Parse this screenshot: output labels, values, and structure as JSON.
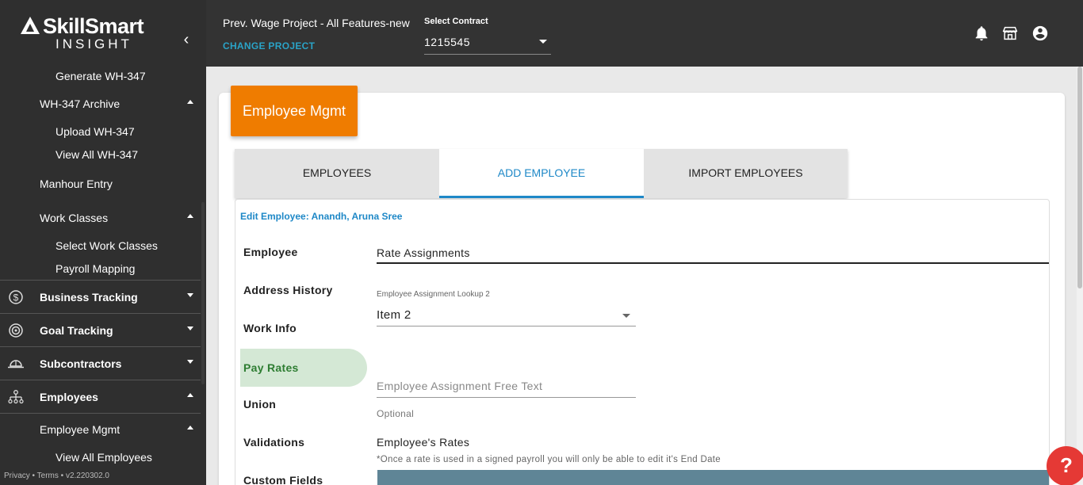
{
  "brand": {
    "name": "SkillSmart",
    "tagline": "INSIGHT"
  },
  "sidebar": {
    "items": [
      {
        "label": "Generate WH-347"
      },
      {
        "label": "WH-347 Archive"
      },
      {
        "label": "Upload WH-347"
      },
      {
        "label": "View All WH-347"
      },
      {
        "label": "Manhour Entry"
      },
      {
        "label": "Work Classes"
      },
      {
        "label": "Select Work Classes"
      },
      {
        "label": "Payroll Mapping"
      },
      {
        "label": "Business Tracking",
        "icon": "dollar-circle-icon"
      },
      {
        "label": "Goal Tracking",
        "icon": "target-icon"
      },
      {
        "label": "Subcontractors",
        "icon": "hardhat-icon"
      },
      {
        "label": "Employees",
        "icon": "org-chart-icon"
      },
      {
        "label": "Employee Mgmt"
      },
      {
        "label": "View All Employees"
      }
    ],
    "footer": "Privacy • Terms • v2.220302.0"
  },
  "header": {
    "project_name": "Prev. Wage Project - All Features-new",
    "change_project": "CHANGE PROJECT",
    "contract_label": "Select Contract",
    "contract_value": "1215545"
  },
  "page": {
    "badge": "Employee Mgmt",
    "tabs": [
      {
        "label": "EMPLOYEES"
      },
      {
        "label": "ADD EMPLOYEE"
      },
      {
        "label": "IMPORT EMPLOYEES"
      }
    ],
    "edit_title": "Edit Employee: Anandh, Aruna Sree",
    "side_nav": [
      {
        "label": "Employee"
      },
      {
        "label": "Address History"
      },
      {
        "label": "Work Info"
      },
      {
        "label": "Pay Rates"
      },
      {
        "label": "Union"
      },
      {
        "label": "Validations"
      },
      {
        "label": "Custom Fields"
      }
    ],
    "form": {
      "section_title": "Rate Assignments",
      "lookup_label": "Employee Assignment Lookup 2",
      "lookup_value": "Item 2",
      "free_text_placeholder": "Employee Assignment Free Text",
      "free_text_helper": "Optional",
      "rates_title": "Employee's Rates",
      "rates_note": "*Once a rate is used in a signed payroll you will only be able to edit it's End Date"
    }
  },
  "help_label": "?",
  "colors": {
    "accent": "#1e88c7",
    "badge": "#ef7c00",
    "active_nav": "#d4e8d5",
    "help": "#e53935"
  }
}
